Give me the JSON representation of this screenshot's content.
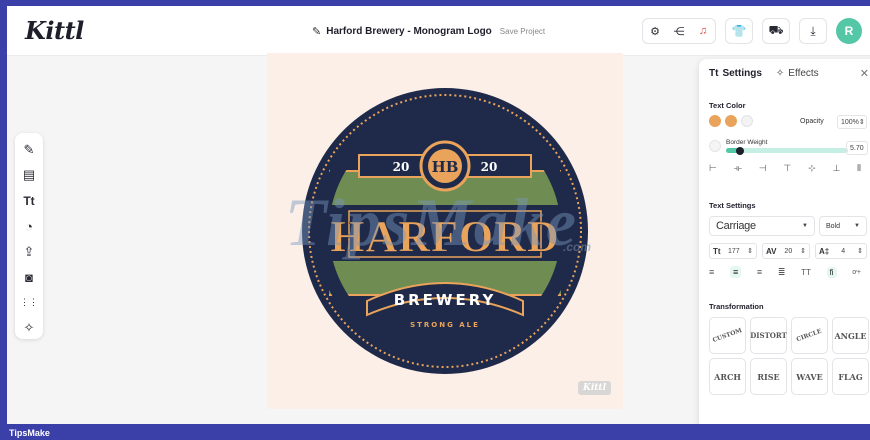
{
  "app": {
    "logo": "Kittl",
    "project_name": "Harford Brewery - Monogram Logo",
    "save_label": "Save Project",
    "avatar_initial": "R",
    "accent": "#53c7a6"
  },
  "top_actions": [
    "settings-icon",
    "share-icon",
    "bell-icon",
    "shirt-icon",
    "truck-icon",
    "download-icon"
  ],
  "toolbar": [
    "edit-icon",
    "layout-icon",
    "text-icon",
    "shapes-icon",
    "upload-icon",
    "camera-icon",
    "grid-icon",
    "sparkle-icon"
  ],
  "artwork": {
    "year_left": "20",
    "year_right": "20",
    "title": "HARFORD",
    "subtitle": "BREWERY",
    "tagline": "STRONG ALE",
    "colors": {
      "navy": "#1f2a4a",
      "orange": "#e9a35a",
      "green": "#6f8c52",
      "cream": "#fcefe8",
      "gold": "#f0c07a"
    }
  },
  "watermark": {
    "text": "TipsMake",
    "suffix": ".com",
    "kittl_badge": "Kittl"
  },
  "panel": {
    "tab_settings": "Settings",
    "tab_effects": "Effects",
    "text_color_label": "Text Color",
    "swatch_colors": [
      "#e9a35a",
      "#e9a35a",
      "#f3f3f3"
    ],
    "opacity_label": "Opacity",
    "opacity_value": "100%",
    "border_weight_label": "Border Weight",
    "border_weight_value": "5.70",
    "border_weight_fraction": 0.06,
    "text_settings_label": "Text Settings",
    "font_family": "Carriage",
    "font_weight": "Bold",
    "font_size": "177",
    "letter_spacing": "20",
    "line_height": "4",
    "transformation_label": "Transformation",
    "transformations": [
      "CUSTOM",
      "DISTORT",
      "CIRCLE",
      "ANGLE",
      "ARCH",
      "RISE",
      "WAVE",
      "FLAG"
    ]
  },
  "footer": {
    "brand": "TipsMake"
  }
}
